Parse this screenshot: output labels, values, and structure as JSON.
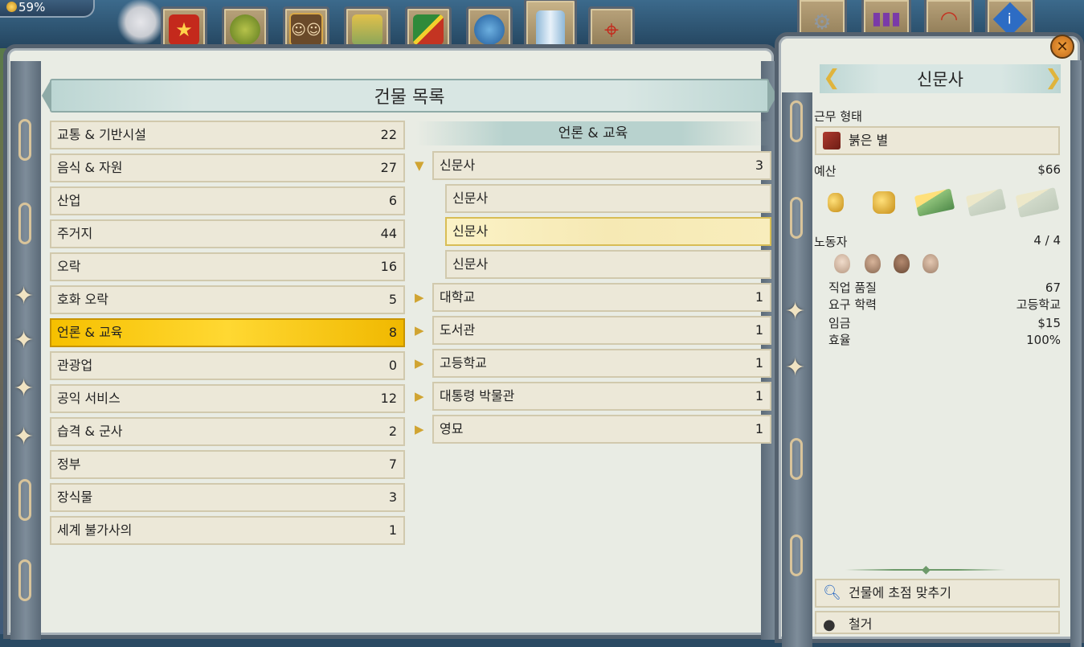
{
  "approval": {
    "value": "59%"
  },
  "top_tabs": [
    {
      "icon": "red-star-icon"
    },
    {
      "icon": "island-icon"
    },
    {
      "icon": "portrait-icon"
    },
    {
      "icon": "money-icon"
    },
    {
      "icon": "flag-icon"
    },
    {
      "icon": "globe-icon"
    },
    {
      "icon": "buildings-icon",
      "active": true
    },
    {
      "icon": "target-icon"
    }
  ],
  "right_tabs": [
    {
      "icon": "gears-icon",
      "active": true
    },
    {
      "icon": "statistics-icon"
    },
    {
      "icon": "gauge-icon"
    },
    {
      "icon": "info-icon"
    }
  ],
  "main": {
    "title": "건물 목록",
    "categories": [
      {
        "label": "교통 & 기반시설",
        "count": "22"
      },
      {
        "label": "음식 & 자원",
        "count": "27"
      },
      {
        "label": "산업",
        "count": "6"
      },
      {
        "label": "주거지",
        "count": "44"
      },
      {
        "label": "오락",
        "count": "16"
      },
      {
        "label": "호화 오락",
        "count": "5"
      },
      {
        "label": "언론 & 교육",
        "count": "8",
        "selected": true
      },
      {
        "label": "관광업",
        "count": "0"
      },
      {
        "label": "공익 서비스",
        "count": "12"
      },
      {
        "label": "습격 & 군사",
        "count": "2"
      },
      {
        "label": "정부",
        "count": "7"
      },
      {
        "label": "장식물",
        "count": "3"
      },
      {
        "label": "세계 불가사의",
        "count": "1"
      }
    ],
    "sub_title": "언론 & 교육",
    "buildings": [
      {
        "label": "신문사",
        "count": "3",
        "expanded": true
      },
      {
        "label": "신문사",
        "count": "",
        "child": true
      },
      {
        "label": "신문사",
        "count": "",
        "child": true,
        "selected": true
      },
      {
        "label": "신문사",
        "count": "",
        "child": true
      },
      {
        "label": "대학교",
        "count": "1"
      },
      {
        "label": "도서관",
        "count": "1"
      },
      {
        "label": "고등학교",
        "count": "1"
      },
      {
        "label": "대통령 박물관",
        "count": "1"
      },
      {
        "label": "영묘",
        "count": "1"
      }
    ]
  },
  "detail": {
    "title": "신문사",
    "work_mode_label": "근무 형태",
    "work_mode_value": "붉은 별",
    "budget_label": "예산",
    "budget_value": "$66",
    "workers_label": "노동자",
    "workers_value": "4 / 4",
    "stats": [
      {
        "label": "직업 품질",
        "value": "67"
      },
      {
        "label": "요구 학력",
        "value": "고등학교"
      },
      {
        "label": "임금",
        "value": "$15"
      },
      {
        "label": "효율",
        "value": "100%"
      }
    ],
    "focus_button": "건물에 초점 맞추기",
    "demolish_button": "철거"
  },
  "colors": {
    "selected_category": "#ffd02a",
    "selected_building": "#f8edbc",
    "frame": "#54616e",
    "banner": "#d8e6e3"
  }
}
